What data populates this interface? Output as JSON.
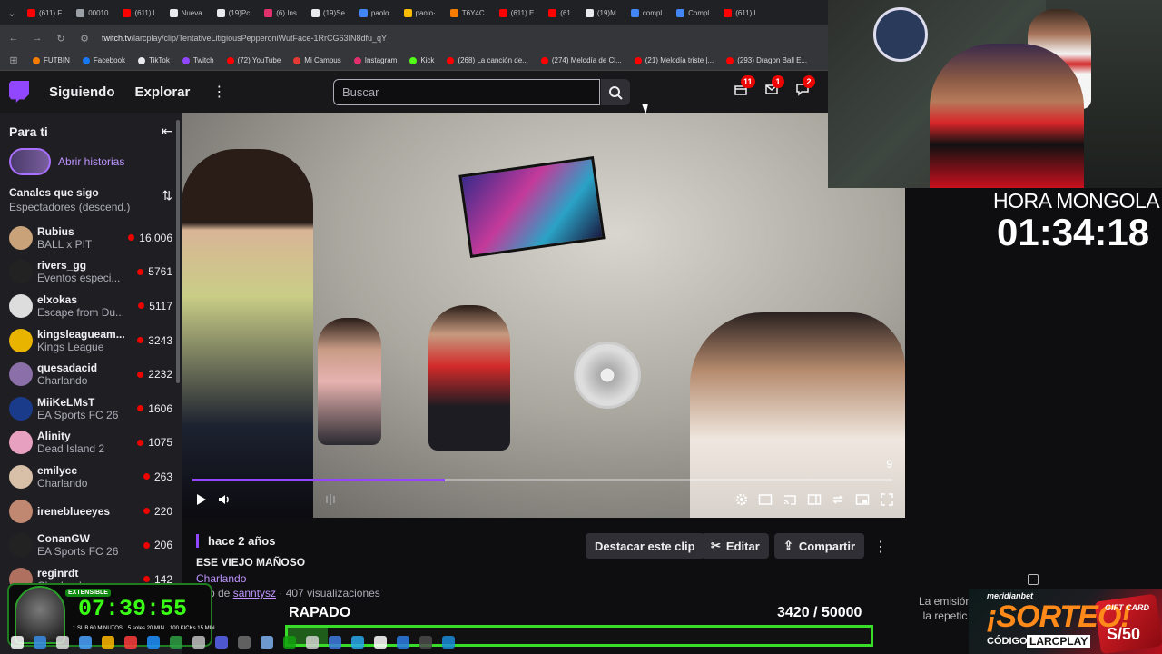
{
  "browser": {
    "tabs": [
      {
        "label": "(611) F",
        "color": "#ff0000"
      },
      {
        "label": "00010",
        "color": "#9aa0a6"
      },
      {
        "label": "(611) l",
        "color": "#ff0000"
      },
      {
        "label": "Nueva",
        "color": "#e8eaed"
      },
      {
        "label": "(19)Pc",
        "color": "#e8eaed"
      },
      {
        "label": "(6) Ins",
        "color": "#e1306c"
      },
      {
        "label": "(19)Se",
        "color": "#e8eaed"
      },
      {
        "label": "paolo",
        "color": "#4285f4"
      },
      {
        "label": "paolo·",
        "color": "#fbbc04"
      },
      {
        "label": "T6Y4C",
        "color": "#f57c00"
      },
      {
        "label": "(611) E",
        "color": "#ff0000"
      },
      {
        "label": "(61",
        "color": "#ff0000"
      },
      {
        "label": "(19)M",
        "color": "#e8eaed"
      },
      {
        "label": "compl",
        "color": "#4285f4"
      },
      {
        "label": "Compl",
        "color": "#4285f4"
      },
      {
        "label": "(611) I",
        "color": "#ff0000"
      }
    ],
    "url_host": "twitch.tv",
    "url_path": "/larcplay/clip/TentativeLitigiousPepperoniWutFace-1RrCG63IN8dfu_qY",
    "bookmarks": [
      {
        "label": "FUTBIN",
        "color": "#f57c00"
      },
      {
        "label": "Facebook",
        "color": "#1877f2"
      },
      {
        "label": "TikTok",
        "color": "#e8eaed"
      },
      {
        "label": "Twitch",
        "color": "#9147ff"
      },
      {
        "label": "(72) YouTube",
        "color": "#ff0000"
      },
      {
        "label": "Mi Campus",
        "color": "#e53935"
      },
      {
        "label": "Instagram",
        "color": "#e1306c"
      },
      {
        "label": "Kick",
        "color": "#53fc18"
      },
      {
        "label": "(268) La canción de...",
        "color": "#ff0000"
      },
      {
        "label": "(274) Melodía de Cl...",
        "color": "#ff0000"
      },
      {
        "label": "(21) Melodía triste |...",
        "color": "#ff0000"
      },
      {
        "label": "(293) Dragon Ball E...",
        "color": "#ff0000"
      }
    ]
  },
  "twitch": {
    "nav": {
      "following": "Siguiendo",
      "browse": "Explorar",
      "search_placeholder": "Buscar",
      "badge_1": "11",
      "badge_2": "1",
      "badge_3": "2"
    },
    "sidebar": {
      "title": "Para ti",
      "stories_label": "Abrir historias",
      "followed_title": "Canales que sigo",
      "followed_sort": "Espectadores (descend.)",
      "channels": [
        {
          "name": "Rubius",
          "game": "BALL x PIT",
          "viewers": "16.006",
          "color": "#c9a27a"
        },
        {
          "name": "rivers_gg",
          "game": "Eventos especi...",
          "viewers": "5761",
          "color": "#222222"
        },
        {
          "name": "elxokas",
          "game": "Escape from Du...",
          "viewers": "5117",
          "color": "#dddddd"
        },
        {
          "name": "kingsleagueam...",
          "game": "Kings League",
          "viewers": "3243",
          "color": "#e8b400"
        },
        {
          "name": "quesadacid",
          "game": "Charlando",
          "viewers": "2232",
          "color": "#8b6fa8"
        },
        {
          "name": "MiiKeLMsT",
          "game": "EA Sports FC 26",
          "viewers": "1606",
          "color": "#1a3a8a"
        },
        {
          "name": "Alinity",
          "game": "Dead Island 2",
          "viewers": "1075",
          "color": "#e8a0c0"
        },
        {
          "name": "emilycc",
          "game": "Charlando",
          "viewers": "263",
          "color": "#d8c0a8"
        },
        {
          "name": "ireneblueeyes",
          "game": "",
          "viewers": "220",
          "color": "#c08870"
        },
        {
          "name": "ConanGW",
          "game": "EA Sports FC 26",
          "viewers": "206",
          "color": "#222222"
        },
        {
          "name": "reginrdt",
          "game": "Charlando",
          "viewers": "142",
          "color": "#b07060"
        }
      ]
    },
    "video": {
      "counter": "9",
      "progress": 0.36
    },
    "clip": {
      "ago": "hace 2 años",
      "title": "ESE VIEJO MAÑOSO",
      "category": "Charlando",
      "clip_by_prefix": "Clip de",
      "clipper": "sanntysz",
      "views": "· 407 visualizaciones",
      "btn_highlight": "Destacar este clip",
      "btn_edit": "Editar",
      "btn_share": "Compartir"
    }
  },
  "overlay": {
    "hora_label": "HORA MONGOLA",
    "hora_value": "01:34:18",
    "rerun_text": "La emisión la repetic",
    "promo_brand": "meridianbet",
    "promo_title": "¡SORTEO!",
    "promo_code_label": "CÓDIGO:",
    "promo_code": "LARCPLAY",
    "promo_card_label": "GIFT CARD",
    "promo_amount": "S/50",
    "timer_badge": "EXTENSIBLE",
    "timer_value": "07:39:55",
    "timer_row": [
      "1 SUB 60 MINUTOS",
      "5 soles 20 MIN",
      "100 KICKs 15 MIN"
    ],
    "goal_label": "RAPADO",
    "goal_current": "3420",
    "goal_total": "/ 50000",
    "goal_fraction": 0.0684
  }
}
